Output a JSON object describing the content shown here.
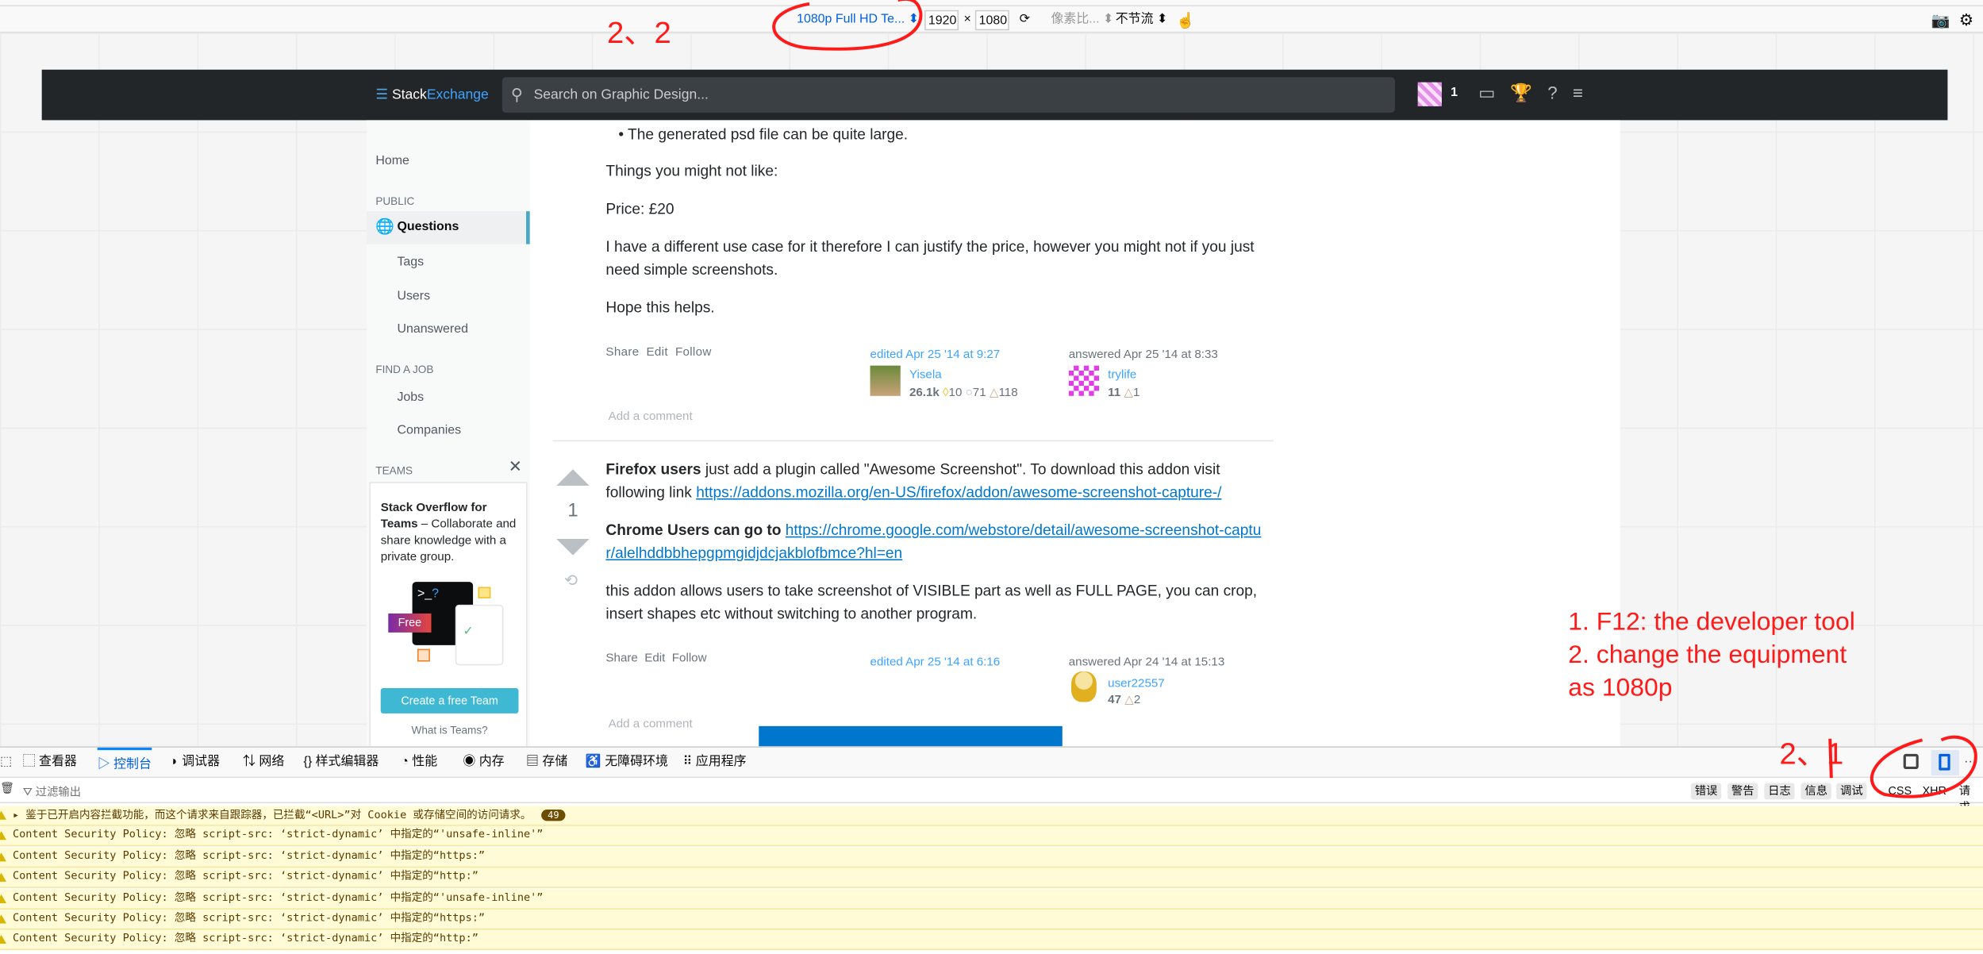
{
  "responsive_toolbar": {
    "device": "1080p Full HD Te...",
    "width": "1920",
    "height": "1080",
    "times": "×",
    "dpr": "像素比...",
    "throttle": "不节流"
  },
  "se_header": {
    "logo_stack": "Stack",
    "logo_exchange": "Exchange",
    "search_placeholder": "Search on Graphic Design...",
    "rep": "1"
  },
  "sidebar": {
    "home": "Home",
    "public": "PUBLIC",
    "questions": "Questions",
    "tags": "Tags",
    "users": "Users",
    "unanswered": "Unanswered",
    "find_job": "FIND A JOB",
    "jobs": "Jobs",
    "companies": "Companies",
    "teams": "TEAMS",
    "teams_bold1": "Stack Overflow for Teams",
    "teams_text": " – Collaborate and share knowledge with a private group.",
    "free": "Free",
    "create_team": "Create a free Team",
    "what_is": "What is Teams?"
  },
  "answer1": {
    "bullet": "The generated psd file can be quite large.",
    "p1": "Things you might not like:",
    "p2": "Price: £20",
    "p3": "I have a different use case for it therefore I can justify the price, however you might not if you just need simple screenshots.",
    "p4": "Hope this helps.",
    "share": "Share",
    "edit": "Edit",
    "follow": "Follow",
    "edited": "edited Apr 25 '14 at 9:27",
    "editor": "Yisela",
    "editor_rep": "26.1k",
    "editor_gold": "10",
    "editor_silver": "71",
    "editor_bronze": "118",
    "answered": "answered Apr 25 '14 at 8:33",
    "author": "trylife",
    "author_rep": "11",
    "author_bronze": "1",
    "add_comment": "Add a comment"
  },
  "answer2": {
    "votes": "1",
    "p1_bold": "Firefox users",
    "p1": " just add a plugin called \"Awesome Screenshot\". To download this addon visit following link ",
    "link1": "https://addons.mozilla.org/en-US/firefox/addon/awesome-screenshot-capture-/",
    "p2_bold": "Chrome Users can go to ",
    "link2": "https://chrome.google.com/webstore/detail/awesome-screenshot-captur/alelhddbbhepgpmgidjdcjakblofbmce?hl=en",
    "p3": "this addon allows users to take screenshot of VISIBLE part as well as FULL PAGE, you can crop, insert shapes etc without switching to another program.",
    "share": "Share",
    "edit": "Edit",
    "follow": "Follow",
    "edited": "edited Apr 25 '14 at 6:16",
    "answered": "answered Apr 24 '14 at 15:13",
    "author": "user22557",
    "author_rep": "47",
    "author_bronze": "2",
    "add_comment": "Add a comment"
  },
  "devtools": {
    "tabs": [
      "查看器",
      "控制台",
      "调试器",
      "网络",
      "样式编辑器",
      "性能",
      "内存",
      "存储",
      "无障碍环境",
      "应用程序"
    ],
    "active_tab": "控制台",
    "filter_placeholder": "过滤输出",
    "filters": [
      "错误",
      "警告",
      "日志",
      "信息",
      "调试"
    ],
    "filters2": [
      "CSS",
      "XHR",
      "请求"
    ],
    "messages": [
      {
        "text": "鉴于已开启内容拦截功能，而这个请求来自跟踪器，已拦截“<URL>”对 Cookie 或存储空间的访问请求。",
        "count": "49"
      },
      {
        "text": "Content Security Policy: 忽略 script-src: ‘strict-dynamic’ 中指定的“'unsafe-inline'”"
      },
      {
        "text": "Content Security Policy: 忽略 script-src: ‘strict-dynamic’ 中指定的“https:”"
      },
      {
        "text": "Content Security Policy: 忽略 script-src: ‘strict-dynamic’ 中指定的“http:”"
      },
      {
        "text": "Content Security Policy: 忽略 script-src: ‘strict-dynamic’ 中指定的“'unsafe-inline'”"
      },
      {
        "text": "Content Security Policy: 忽略 script-src: ‘strict-dynamic’ 中指定的“https:”"
      },
      {
        "text": "Content Security Policy: 忽略 script-src: ‘strict-dynamic’ 中指定的“http:”"
      }
    ]
  },
  "annotations": {
    "label_22": "2、2",
    "label_21": "2、1",
    "instructions": [
      "1. F12: the developer tool",
      "2. change the equipment",
      "as 1080p"
    ],
    "color": "#ff1a1a"
  }
}
